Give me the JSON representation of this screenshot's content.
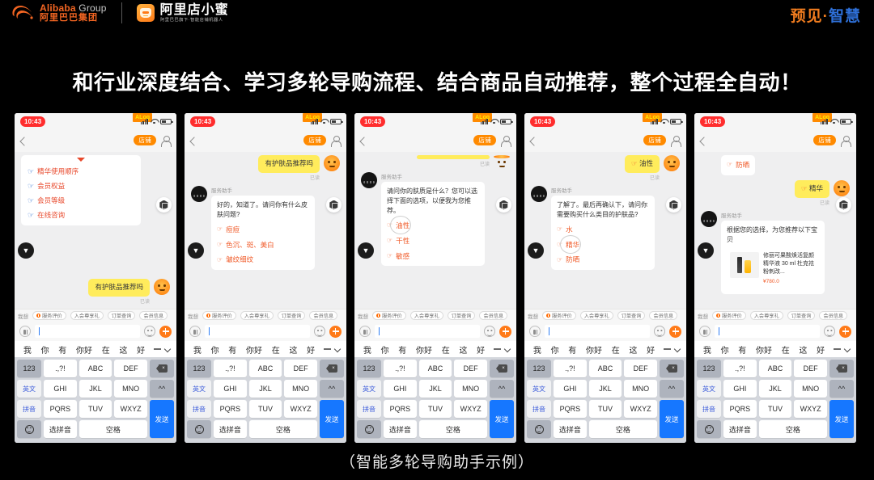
{
  "header": {
    "alibaba_en": "Alibaba",
    "alibaba_en_suffix": "Group",
    "alibaba_cn": "阿里巴巴集团",
    "product_title": "阿里店小蜜",
    "product_sub": "阿里巴巴旗下·智能店铺机器人",
    "right_brand_orange": "预见",
    "right_brand_dot": "·",
    "right_brand_blue": "智慧"
  },
  "main_title": "和行业深度结合、学习多轮导购流程、结合商品自动推荐，整个过程全自动！",
  "caption": "（智能多轮导购助手示例）",
  "colors": {
    "brand_orange": "#f26522",
    "brand_blue": "#2e6fd6",
    "bubble_user": "#ffec5c",
    "send_key": "#1677ff",
    "accent_red": "#ff2d2d"
  },
  "phone_common": {
    "status_time": "10:43",
    "status_badge": "ALog",
    "nav_shop_badge": "店铺",
    "sender_name": "服务助手",
    "read_mark": "已读",
    "quick_tabs_label": "我想",
    "quick_tabs": [
      "服务评价",
      "入会尊享礼",
      "订单查询",
      "会员信息"
    ],
    "keyboard": {
      "suggestions": [
        "我",
        "你",
        "有",
        "你好",
        "在",
        "这",
        "好"
      ],
      "keys": {
        "num": "123",
        "english": "英文",
        "pinyin": "拼音",
        "punct": ".,?!",
        "abc": "ABC",
        "def": "DEF",
        "ghi": "GHI",
        "jkl": "JKL",
        "mno": "MNO",
        "pqrs": "PQRS",
        "tuv": "TUV",
        "wxyz": "WXYZ",
        "select_pinyin": "选拼音",
        "space": "空格",
        "shift": "^^",
        "send": "发送"
      }
    }
  },
  "phones": [
    {
      "id": "phone-1",
      "list_card_options": [
        "精华使用顺序",
        "会员权益",
        "会员等级",
        "在线咨询"
      ],
      "user_message": "有护肤品推荐吗"
    },
    {
      "id": "phone-2",
      "user_message": "有护肤品推荐吗",
      "bot_text": "好的，知道了。请问你有什么皮肤问题?",
      "bot_options": [
        "痘痘",
        "色沉、斑、美白",
        "皱纹细纹"
      ]
    },
    {
      "id": "phone-3",
      "bot_text": "请问你的肤质是什么？您可以选择下面的选项，以便我为您推荐。",
      "bot_options": [
        "油性",
        "干性",
        "敏感"
      ],
      "highlighted_option": "油性"
    },
    {
      "id": "phone-4",
      "user_message": "油性",
      "bot_text": "了解了。最后再确认下，请问你需要购买什么类目的护肤品?",
      "bot_options": [
        "水",
        "精华",
        "防晒"
      ],
      "highlighted_option": "精华"
    },
    {
      "id": "phone-5",
      "prev_option": "防晒",
      "user_message": "精华",
      "bot_text": "根据您的选择，为您推荐以下宝贝",
      "product_name": "修丽可果酸焕活复颜精华液 30 ml 杜克祛粉刺改...",
      "product_price": "¥780.0"
    }
  ]
}
